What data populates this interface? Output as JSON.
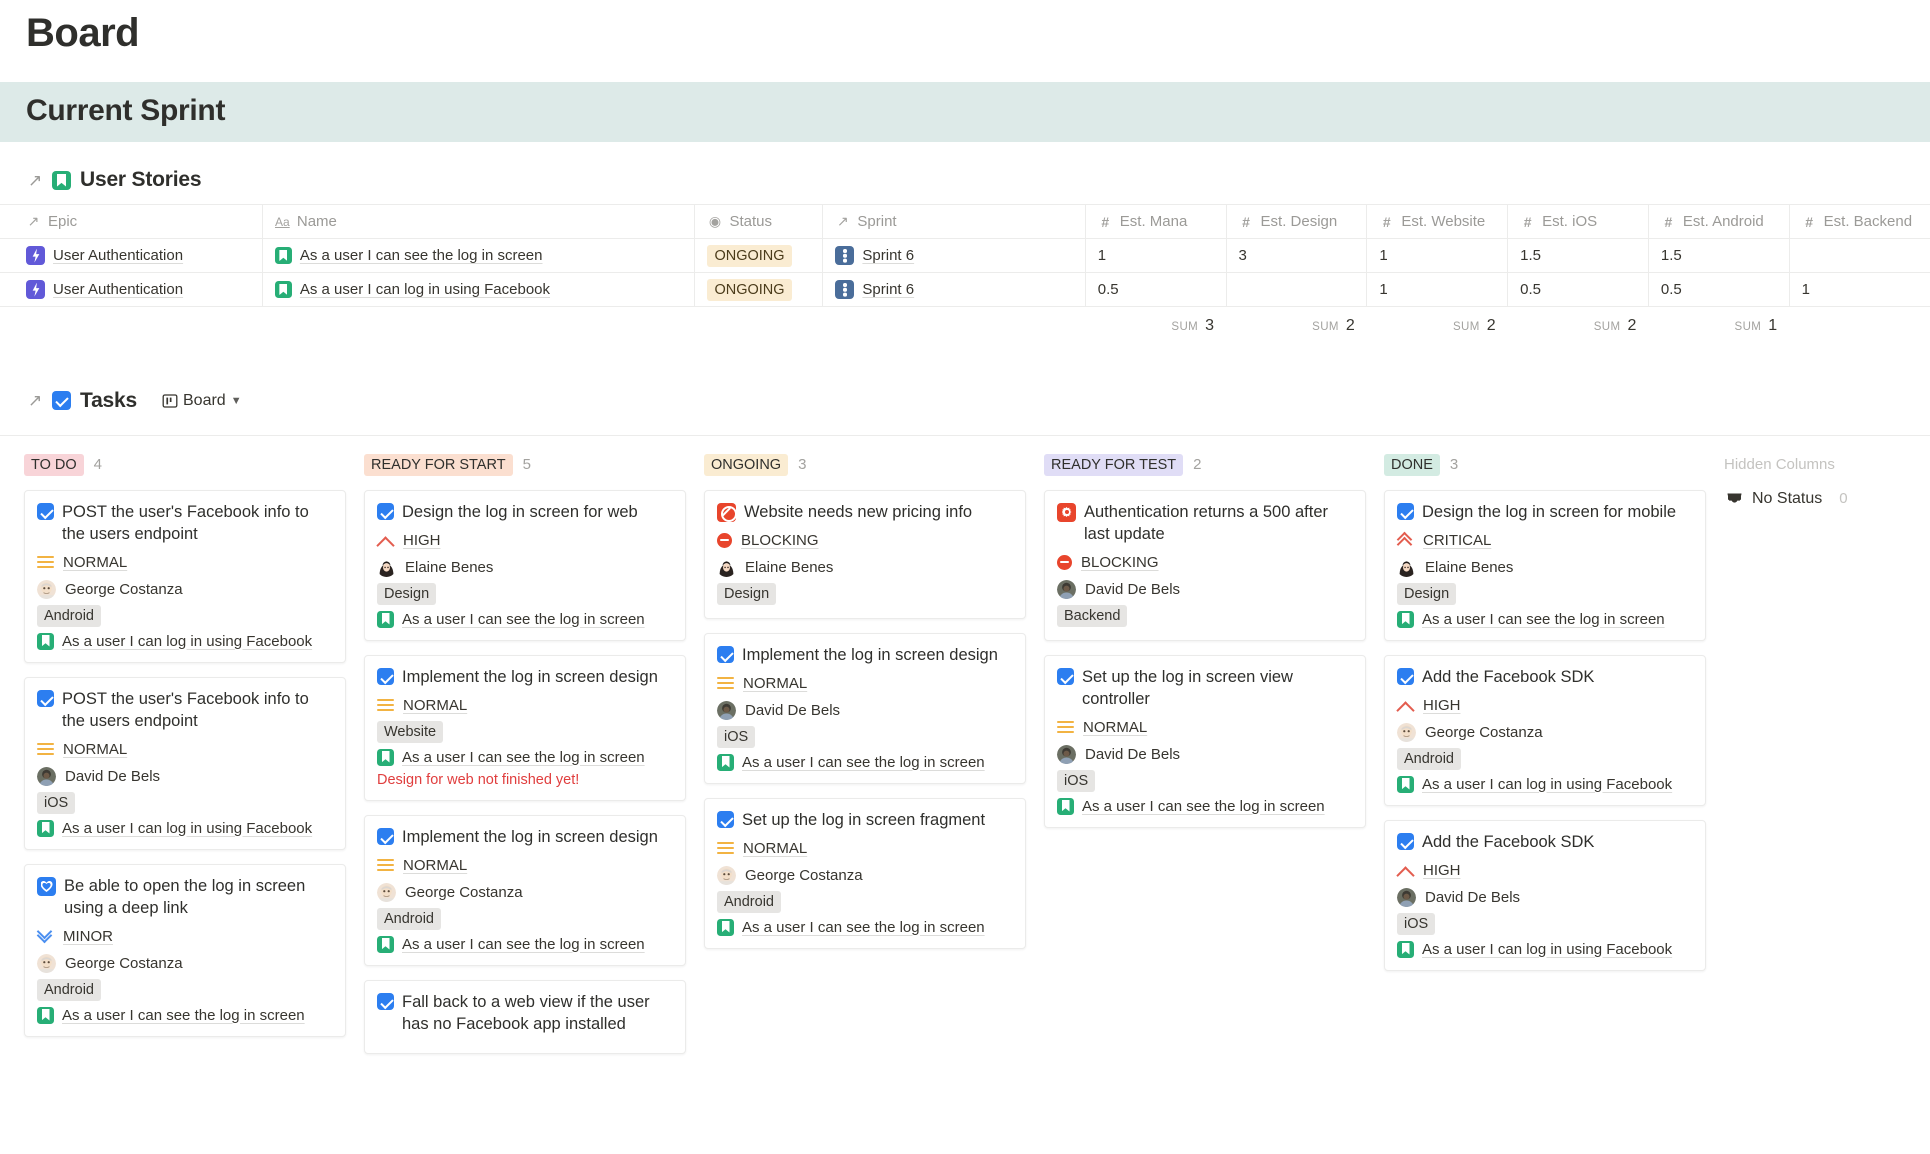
{
  "page": {
    "title": "Board"
  },
  "sprint_section": {
    "heading": "Current Sprint"
  },
  "user_stories": {
    "title": "User Stories",
    "columns": [
      {
        "label": "Epic",
        "icon": "relation-arrow-icon"
      },
      {
        "label": "Name",
        "icon": "title-aa-icon"
      },
      {
        "label": "Status",
        "icon": "select-icon"
      },
      {
        "label": "Sprint",
        "icon": "relation-arrow-icon"
      },
      {
        "label": "Est. Mana",
        "icon": "number-hash-icon"
      },
      {
        "label": "Est. Design",
        "icon": "number-hash-icon"
      },
      {
        "label": "Est. Website",
        "icon": "number-hash-icon"
      },
      {
        "label": "Est. iOS",
        "icon": "number-hash-icon"
      },
      {
        "label": "Est. Android",
        "icon": "number-hash-icon"
      },
      {
        "label": "Est. Backend",
        "icon": "number-hash-icon"
      }
    ],
    "rows": [
      {
        "epic": "User Authentication",
        "name": "As a user I can see the log in screen",
        "status": "ONGOING",
        "sprint": "Sprint 6",
        "est_mana": "1",
        "est_design": "3",
        "est_website": "1",
        "est_ios": "1.5",
        "est_android": "1.5",
        "est_backend": ""
      },
      {
        "epic": "User Authentication",
        "name": "As a user I can log in using Facebook",
        "status": "ONGOING",
        "sprint": "Sprint 6",
        "est_mana": "0.5",
        "est_design": "",
        "est_website": "1",
        "est_ios": "0.5",
        "est_android": "0.5",
        "est_backend": "1"
      }
    ],
    "sum_label": "SUM",
    "sums": {
      "est_mana": "3",
      "est_design": "2",
      "est_website": "2",
      "est_ios": "2",
      "est_android": "1"
    }
  },
  "tasks": {
    "title": "Tasks",
    "view_label": "Board",
    "hidden_columns_label": "Hidden Columns",
    "hidden_columns": [
      {
        "label": "No Status",
        "count": "0",
        "icon": "inbox-icon"
      }
    ],
    "columns": [
      {
        "name": "TO DO",
        "count": "4",
        "chip_bg": "#f8d4d8",
        "cards": [
          {
            "icon": "task-icon",
            "title": "POST the user's Facebook info to the users endpoint",
            "priority": "NORMAL",
            "priority_kind": "normal",
            "assignee": "George Costanza",
            "avatar": "george",
            "tag": "Android",
            "relation": "As a user I can log in using Facebook"
          },
          {
            "icon": "task-icon",
            "title": "POST the user's Facebook info to the users endpoint",
            "priority": "NORMAL",
            "priority_kind": "normal",
            "assignee": "David De Bels",
            "avatar": "david",
            "tag": "iOS",
            "relation": "As a user I can log in using Facebook"
          },
          {
            "icon": "heart-icon",
            "title": "Be able to open the log in screen using a deep link",
            "priority": "MINOR",
            "priority_kind": "minor",
            "assignee": "George Costanza",
            "avatar": "george",
            "tag": "Android",
            "relation": "As a user I can see the log in screen"
          }
        ]
      },
      {
        "name": "READY FOR START",
        "count": "5",
        "chip_bg": "#fbdfd0",
        "cards": [
          {
            "icon": "task-icon",
            "title": "Design the log in screen for web",
            "priority": "HIGH",
            "priority_kind": "high",
            "assignee": "Elaine Benes",
            "avatar": "elaine",
            "tag": "Design",
            "relation": "As a user I can see the log in screen"
          },
          {
            "icon": "task-icon",
            "title": "Implement the log in screen design",
            "priority": "NORMAL",
            "priority_kind": "normal",
            "assignee": "",
            "avatar": "",
            "tag": "Website",
            "relation": "As a user I can see the log in screen",
            "warning": "Design for web not finished yet!"
          },
          {
            "icon": "task-icon",
            "title": "Implement the log in screen design",
            "priority": "NORMAL",
            "priority_kind": "normal",
            "assignee": "George Costanza",
            "avatar": "george",
            "tag": "Android",
            "relation": "As a user I can see the log in screen"
          },
          {
            "icon": "task-icon",
            "title": "Fall back to a web view if the user has no Facebook app installed",
            "priority": "",
            "priority_kind": "",
            "assignee": "",
            "avatar": "",
            "tag": "",
            "relation": ""
          }
        ]
      },
      {
        "name": "ONGOING",
        "count": "3",
        "chip_bg": "#faecd2",
        "cards": [
          {
            "icon": "blocked-icon",
            "title": "Website needs new pricing info",
            "priority": "BLOCKING",
            "priority_kind": "blocking",
            "assignee": "Elaine Benes",
            "avatar": "elaine",
            "tag": "Design",
            "relation": ""
          },
          {
            "icon": "task-icon",
            "title": "Implement the log in screen design",
            "priority": "NORMAL",
            "priority_kind": "normal",
            "assignee": "David De Bels",
            "avatar": "david",
            "tag": "iOS",
            "relation": "As a user I can see the log in screen"
          },
          {
            "icon": "task-icon",
            "title": "Set up the log in screen fragment",
            "priority": "NORMAL",
            "priority_kind": "normal",
            "assignee": "George Costanza",
            "avatar": "george",
            "tag": "Android",
            "relation": "As a user I can see the log in screen"
          }
        ]
      },
      {
        "name": "READY FOR TEST",
        "count": "2",
        "chip_bg": "#e0ddf6",
        "cards": [
          {
            "icon": "bug-icon",
            "title": "Authentication returns a 500 after last update",
            "priority": "BLOCKING",
            "priority_kind": "blocking",
            "assignee": "David De Bels",
            "avatar": "david",
            "tag": "Backend",
            "relation": ""
          },
          {
            "icon": "task-icon",
            "title": "Set up the log in screen view controller",
            "priority": "NORMAL",
            "priority_kind": "normal",
            "assignee": "David De Bels",
            "avatar": "david",
            "tag": "iOS",
            "relation": "As a user I can see the log in screen"
          }
        ]
      },
      {
        "name": "DONE",
        "count": "3",
        "chip_bg": "#d3ebe2",
        "cards": [
          {
            "icon": "task-icon",
            "title": "Design the log in screen for mobile",
            "priority": "CRITICAL",
            "priority_kind": "critical",
            "assignee": "Elaine Benes",
            "avatar": "elaine",
            "tag": "Design",
            "relation": "As a user I can see the log in screen"
          },
          {
            "icon": "task-icon",
            "title": "Add the Facebook SDK",
            "priority": "HIGH",
            "priority_kind": "high",
            "assignee": "George Costanza",
            "avatar": "george",
            "tag": "Android",
            "relation": "As a user I can log in using Facebook"
          },
          {
            "icon": "task-icon",
            "title": "Add the Facebook SDK",
            "priority": "HIGH",
            "priority_kind": "high",
            "assignee": "David De Bels",
            "avatar": "david",
            "tag": "iOS",
            "relation": "As a user I can log in using Facebook"
          }
        ]
      }
    ]
  }
}
